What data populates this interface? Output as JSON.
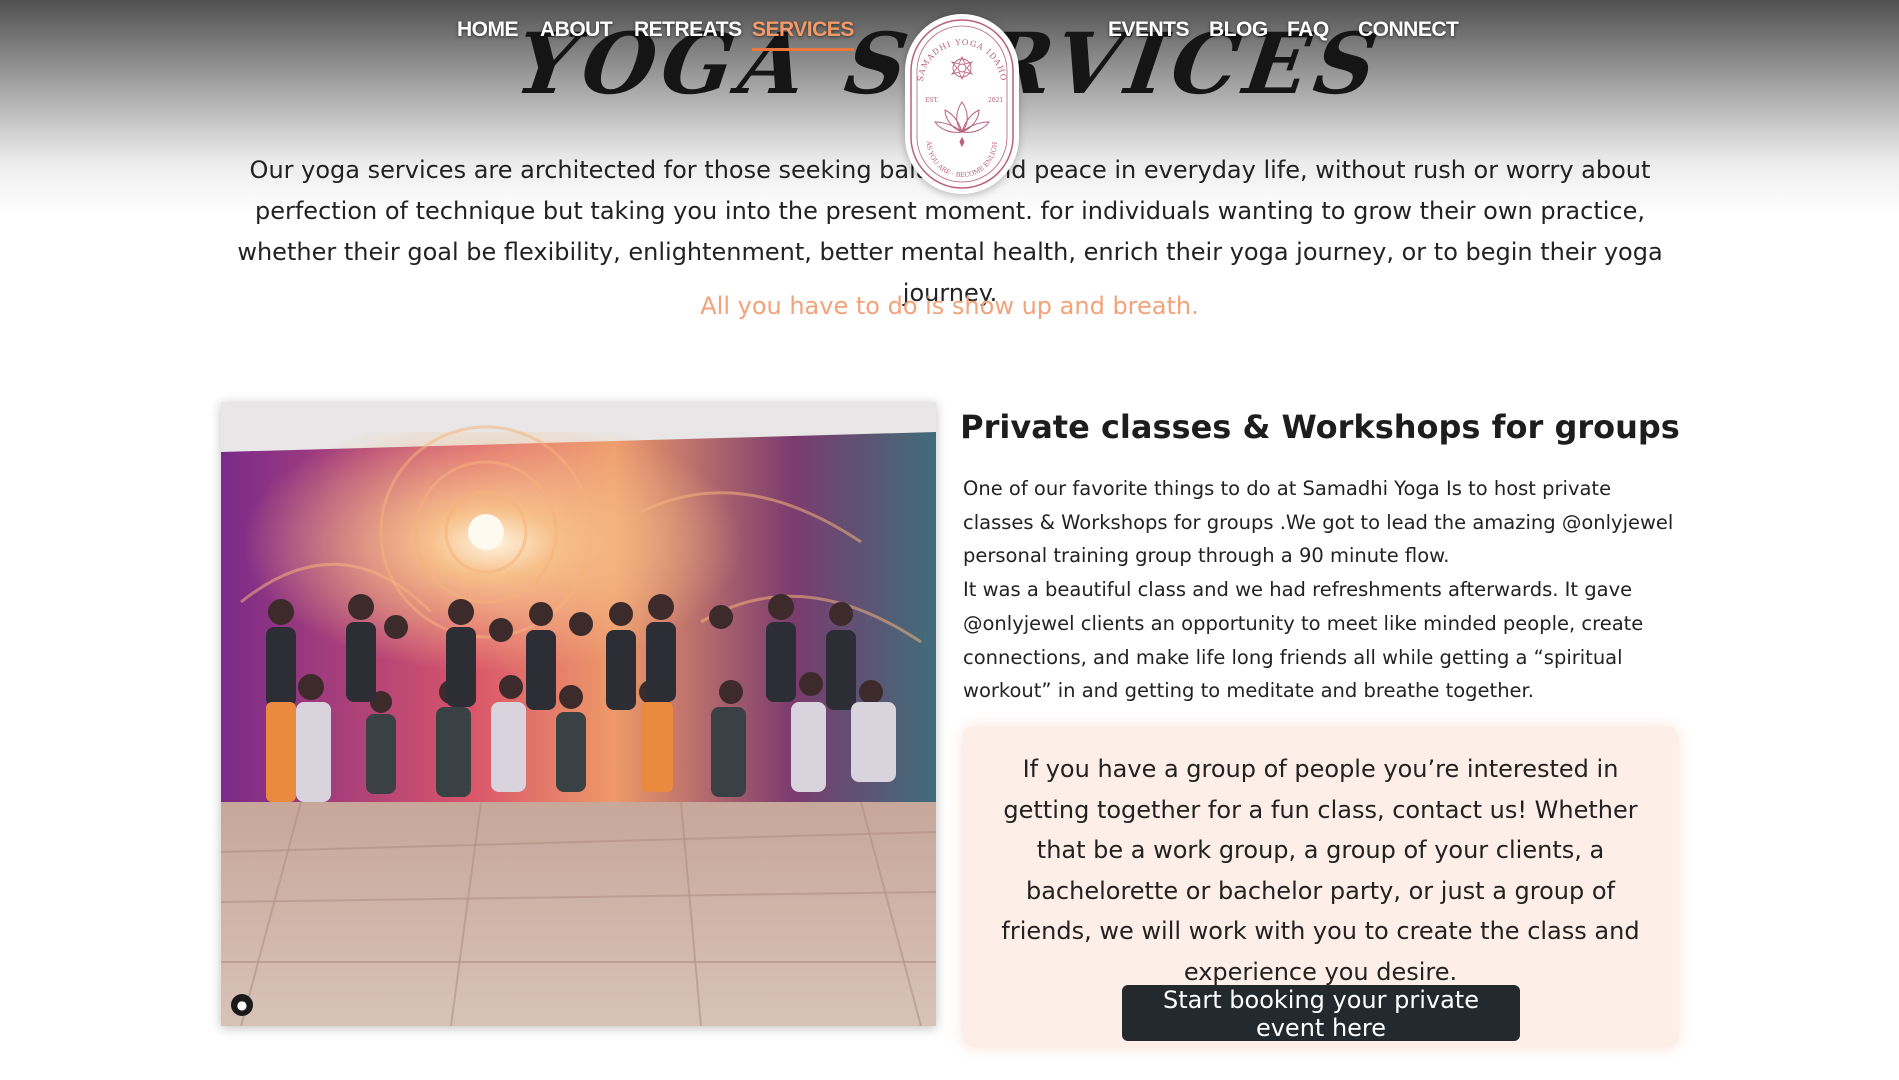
{
  "nav": {
    "items": [
      {
        "label": "HOME",
        "active": false
      },
      {
        "label": "ABOUT",
        "active": false
      },
      {
        "label": "RETREATS",
        "active": false
      },
      {
        "label": "SERVICES",
        "active": true
      },
      {
        "label": "EVENTS",
        "active": false
      },
      {
        "label": "BLOG",
        "active": false
      },
      {
        "label": "FAQ",
        "active": false
      },
      {
        "label": "CONNECT",
        "active": false
      }
    ]
  },
  "logo": {
    "top_text": "SAMADHI YOGA IDAHO",
    "left_text": "EST.",
    "right_text": "2021",
    "bottom_text": "COME AS YOU ARE · BECOME ENLIGHTENED"
  },
  "page_title": "YOGA SERVICES",
  "intro": "Our yoga services are architected for those seeking balance and peace in everyday life, without rush or worry about perfection of technique but taking you into the present moment. for individuals wanting to grow their own practice, whether their goal be flexibility, enlightenment, better mental health, enrich their yoga journey, or to begin their yoga journey.",
  "tagline": "All you have to do is show up and breath.",
  "section": {
    "heading": "Private classes & Workshops for groups",
    "paragraph_1": "One of our favorite things to do at Samadhi Yoga Is to host private classes & Workshops for groups .We got to lead the amazing @onlyjewel personal training group through a 90 minute flow.",
    "paragraph_2": "It was a beautiful class and we had refreshments afterwards. It gave @onlyjewel clients an opportunity to meet like minded people, create connections, and make life long friends all while getting a “spiritual workout” in and getting to meditate and breathe together.",
    "cta_text": "If you have a group of people you’re interested in getting together for a fun class, contact us! Whether that be a work group, a group of your clients, a bachelorette or bachelor party, or just a group of friends, we will work with you to create the class and experience you desire.",
    "cta_button": "Start booking your private event here"
  },
  "colors": {
    "accent": "#e8763d",
    "tagline": "#f4a27a",
    "cta_background": "#fdeee8",
    "button": "#23292d"
  },
  "icons": {
    "photo_overlay": "person-icon"
  }
}
